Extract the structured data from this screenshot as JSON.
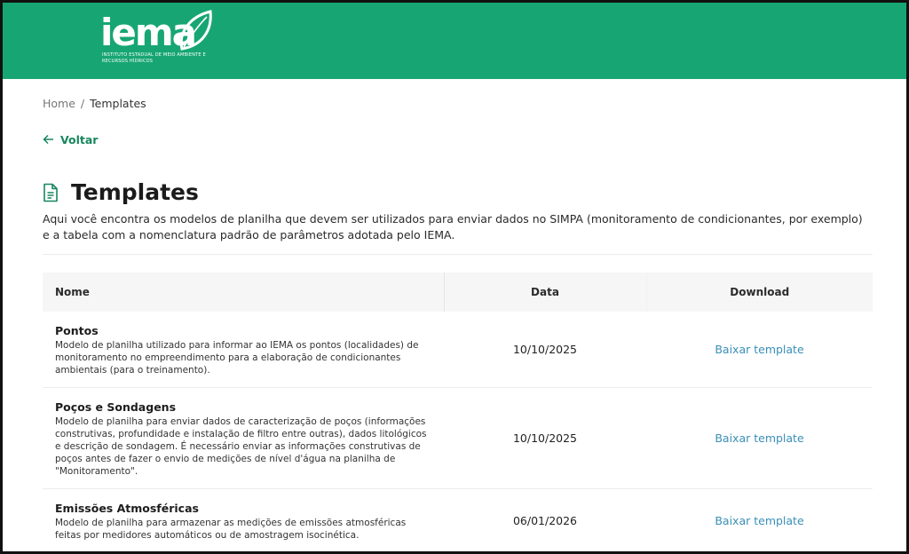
{
  "brand": {
    "logo_text": "iema",
    "logo_subtitle": "INSTITUTO ESTADUAL DE MEIO AMBIENTE E RECURSOS HÍDRICOS",
    "header_color": "#17a673"
  },
  "breadcrumb": {
    "home": "Home",
    "separator": "/",
    "current": "Templates"
  },
  "back": {
    "label": "Voltar",
    "icon": "arrow-left-icon"
  },
  "page": {
    "title": "Templates",
    "title_icon": "document-icon",
    "description": "Aqui você encontra os modelos de planilha que devem ser utilizados para enviar dados no SIMPA (monitoramento de condicionantes, por exemplo) e a tabela com a nomenclatura padrão de parâmetros adotada pelo IEMA."
  },
  "table": {
    "headers": {
      "name": "Nome",
      "date": "Data",
      "download": "Download"
    },
    "rows": [
      {
        "title": "Pontos",
        "description": "Modelo de planilha utilizado para informar ao IEMA os pontos (localidades) de monitoramento no empreendimento para a elaboração de condicionantes ambientais (para o treinamento).",
        "date": "10/10/2025",
        "download_label": "Baixar template"
      },
      {
        "title": "Poços e Sondagens",
        "description": "Modelo de planilha para enviar dados de caracterização de poços (informações construtivas, profundidade e instalação de filtro entre outras), dados litológicos e descrição de sondagem. É necessário enviar as informações construtivas de poços antes de fazer o envio de medições de nível d'água na planilha de \"Monitoramento\".",
        "date": "10/10/2025",
        "download_label": "Baixar template"
      },
      {
        "title": "Emissões Atmosféricas",
        "description": "Modelo de planilha para armazenar as medições de emissões atmosféricas feitas por medidores automáticos ou de amostragem isocinética.",
        "date": "06/01/2026",
        "download_label": "Baixar template"
      }
    ]
  },
  "colors": {
    "accent": "#17875e",
    "link": "#3a8fb7"
  }
}
